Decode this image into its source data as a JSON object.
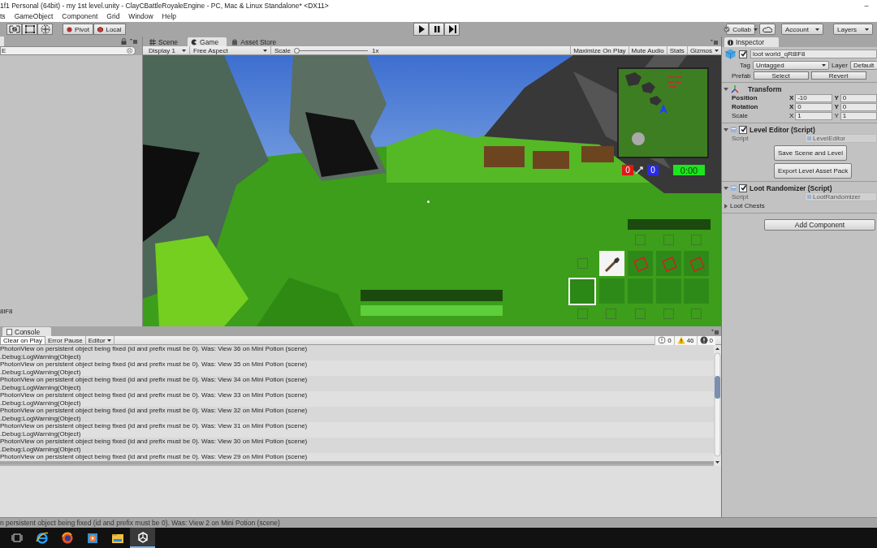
{
  "window": {
    "title": "1f1 Personal (64bit) - my 1st level.unity - ClayCBattleRoyaleEngine - PC, Mac & Linux Standalone* <DX11>",
    "minimize": "–"
  },
  "menu": [
    "ts",
    "GameObject",
    "Component",
    "Grid",
    "Window",
    "Help"
  ],
  "toolbar": {
    "tools": [
      {
        "kind": "scale"
      },
      {
        "kind": "rect"
      },
      {
        "kind": "transform"
      }
    ],
    "pivot": "Pivot",
    "local": "Local",
    "playback": [
      {
        "kind": "play"
      },
      {
        "kind": "pause"
      },
      {
        "kind": "step"
      }
    ],
    "collab": "Collab",
    "account": "Account",
    "layers": "Layers"
  },
  "hierarchy": {
    "search": "E",
    "selected_item": "8lF8"
  },
  "game_view": {
    "tabs": [
      {
        "label": "Scene",
        "kind": "scene",
        "selected": false
      },
      {
        "label": "Game",
        "kind": "game",
        "selected": true
      },
      {
        "label": "Asset Store",
        "kind": "store",
        "selected": false
      }
    ],
    "display": "Display 1",
    "aspect": "Free Aspect",
    "scale_label": "Scale",
    "scale": {
      "level": 0
    },
    "scale_value": "1x",
    "options": [
      "Maximize On Play",
      "Mute Audio",
      "Stats",
      "Gizmos"
    ],
    "hud": {
      "scores": [
        {
          "text": "0",
          "color": "#e01818"
        },
        {
          "text": "0",
          "color": "#2a2ae6"
        }
      ],
      "timer": "0:00",
      "status_bars": [
        {
          "level": 0
        },
        {
          "level": 1
        }
      ],
      "items": [
        {
          "kind": "wand"
        },
        {
          "kind": "crate"
        },
        {
          "kind": "crate"
        },
        {
          "kind": "crate"
        }
      ],
      "hotbar": [
        {
          "selected": true
        },
        {
          "selected": false
        },
        {
          "selected": false
        },
        {
          "selected": false
        },
        {
          "selected": false
        }
      ]
    }
  },
  "console": {
    "tab": "Console",
    "buttons": [
      {
        "label": "Clear on Play",
        "kind": "toggle",
        "on": true
      },
      {
        "label": "Error Pause",
        "kind": "toggle",
        "on": false
      },
      {
        "label": "Editor",
        "kind": "dropdown",
        "on": false
      }
    ],
    "counters": [
      {
        "kind": "info",
        "count": "0"
      },
      {
        "kind": "warning",
        "count": "46"
      },
      {
        "kind": "error",
        "count": "0"
      }
    ],
    "rows": [
      {
        "message": "PhotonView on persistent object being fixed (id and prefix must be 0). Was: View 36 on Mini Potion (scene)",
        "trace": ".Debug:LogWarning(Object)"
      },
      {
        "message": "PhotonView on persistent object being fixed (id and prefix must be 0). Was: View 35 on Mini Potion (scene)",
        "trace": ".Debug:LogWarning(Object)"
      },
      {
        "message": "PhotonView on persistent object being fixed (id and prefix must be 0). Was: View 34 on Mini Potion (scene)",
        "trace": ".Debug:LogWarning(Object)"
      },
      {
        "message": "PhotonView on persistent object being fixed (id and prefix must be 0). Was: View 33 on Mini Potion (scene)",
        "trace": ".Debug:LogWarning(Object)"
      },
      {
        "message": "PhotonView on persistent object being fixed (id and prefix must be 0). Was: View 32 on Mini Potion (scene)",
        "trace": ".Debug:LogWarning(Object)"
      },
      {
        "message": "PhotonView on persistent object being fixed (id and prefix must be 0). Was: View 31 on Mini Potion (scene)",
        "trace": ".Debug:LogWarning(Object)"
      },
      {
        "message": "PhotonView on persistent object being fixed (id and prefix must be 0). Was: View 30 on Mini Potion (scene)",
        "trace": ".Debug:LogWarning(Object)"
      },
      {
        "message": "PhotonView on persistent object being fixed (id and prefix must be 0). Was: View 29 on Mini Potion (scene)"
      }
    ]
  },
  "inspector": {
    "tab": "Inspector",
    "object": {
      "active": true,
      "name": "loot world_qR8lF8",
      "tag_label": "Tag",
      "tag": "Untagged",
      "layer_label": "Layer",
      "layer": "Default",
      "prefab_label": "Prefab",
      "prefab_buttons": [
        "Select",
        "Revert"
      ]
    },
    "components": [
      {
        "kind": "transform",
        "title": "Transform",
        "expanded": true,
        "rows": [
          {
            "label": "Position",
            "modified": true,
            "axes": [
              {
                "label": "X",
                "value": "-10"
              },
              {
                "label": "Y",
                "value": "0"
              }
            ]
          },
          {
            "label": "Rotation",
            "modified": true,
            "axes": [
              {
                "label": "X",
                "value": "0"
              },
              {
                "label": "Y",
                "value": "0"
              }
            ]
          },
          {
            "label": "Scale",
            "modified": false,
            "axes": [
              {
                "label": "X",
                "value": "1"
              },
              {
                "label": "Y",
                "value": "1"
              }
            ]
          }
        ]
      },
      {
        "kind": "script",
        "title": "Level Editor (Script)",
        "enabled": true,
        "expanded": true,
        "script_label": "Script",
        "script": "LevelEditor",
        "buttons": [
          "Save Scene and Level",
          "Export Level Asset Pack"
        ]
      },
      {
        "kind": "script",
        "title": "Loot Randomizer (Script)",
        "enabled": true,
        "expanded": true,
        "script_label": "Script",
        "script": "LootRandomizer",
        "foldouts": [
          {
            "label": "Loot Chests",
            "expanded": false
          }
        ]
      }
    ],
    "add_component": "Add Component"
  },
  "status_bar": "n persistent object being fixed (id and prefix must be 0). Was: View 2 on Mini Potion (scene)",
  "taskbar": {
    "apps": [
      {
        "kind": "taskview",
        "active": false
      },
      {
        "kind": "ie",
        "active": false
      },
      {
        "kind": "firefox",
        "active": false
      },
      {
        "kind": "media",
        "active": false
      },
      {
        "kind": "explorer",
        "active": false
      },
      {
        "kind": "unity",
        "active": true
      }
    ]
  }
}
